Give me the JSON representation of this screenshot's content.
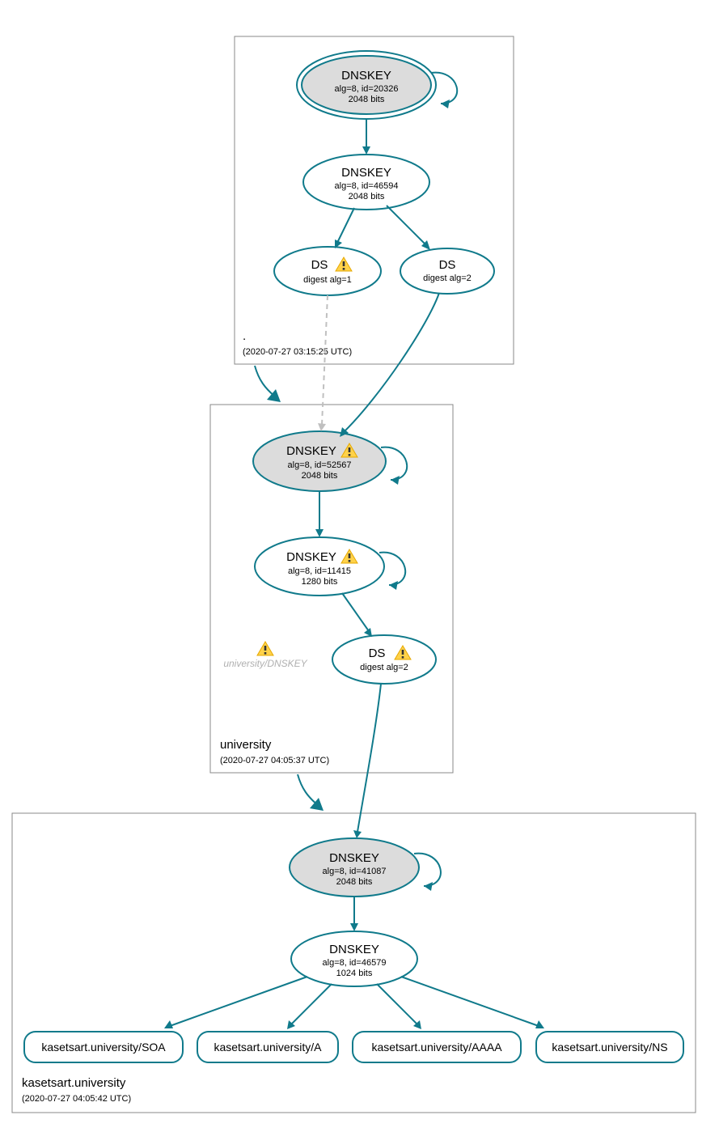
{
  "zones": {
    "root": {
      "title": ".",
      "timestamp": "(2020-07-27 03:15:25 UTC)"
    },
    "university": {
      "title": "university",
      "timestamp": "(2020-07-27 04:05:37 UTC)"
    },
    "kasetsart": {
      "title": "kasetsart.university",
      "timestamp": "(2020-07-27 04:05:42 UTC)"
    }
  },
  "nodes": {
    "root_ksk": {
      "title": "DNSKEY",
      "line1": "alg=8, id=20326",
      "line2": "2048 bits"
    },
    "root_zsk": {
      "title": "DNSKEY",
      "line1": "alg=8, id=46594",
      "line2": "2048 bits"
    },
    "root_ds1": {
      "title": "DS",
      "line1": "digest alg=1"
    },
    "root_ds2": {
      "title": "DS",
      "line1": "digest alg=2"
    },
    "uni_ksk": {
      "title": "DNSKEY",
      "line1": "alg=8, id=52567",
      "line2": "2048 bits"
    },
    "uni_zsk": {
      "title": "DNSKEY",
      "line1": "alg=8, id=11415",
      "line2": "1280 bits"
    },
    "uni_ghost": {
      "title": "university/DNSKEY"
    },
    "uni_ds": {
      "title": "DS",
      "line1": "digest alg=2"
    },
    "kas_ksk": {
      "title": "DNSKEY",
      "line1": "alg=8, id=41087",
      "line2": "2048 bits"
    },
    "kas_zsk": {
      "title": "DNSKEY",
      "line1": "alg=8, id=46579",
      "line2": "1024 bits"
    },
    "kas_soa": {
      "title": "kasetsart.university/SOA"
    },
    "kas_a": {
      "title": "kasetsart.university/A"
    },
    "kas_aaaa": {
      "title": "kasetsart.university/AAAA"
    },
    "kas_ns": {
      "title": "kasetsart.university/NS"
    }
  }
}
